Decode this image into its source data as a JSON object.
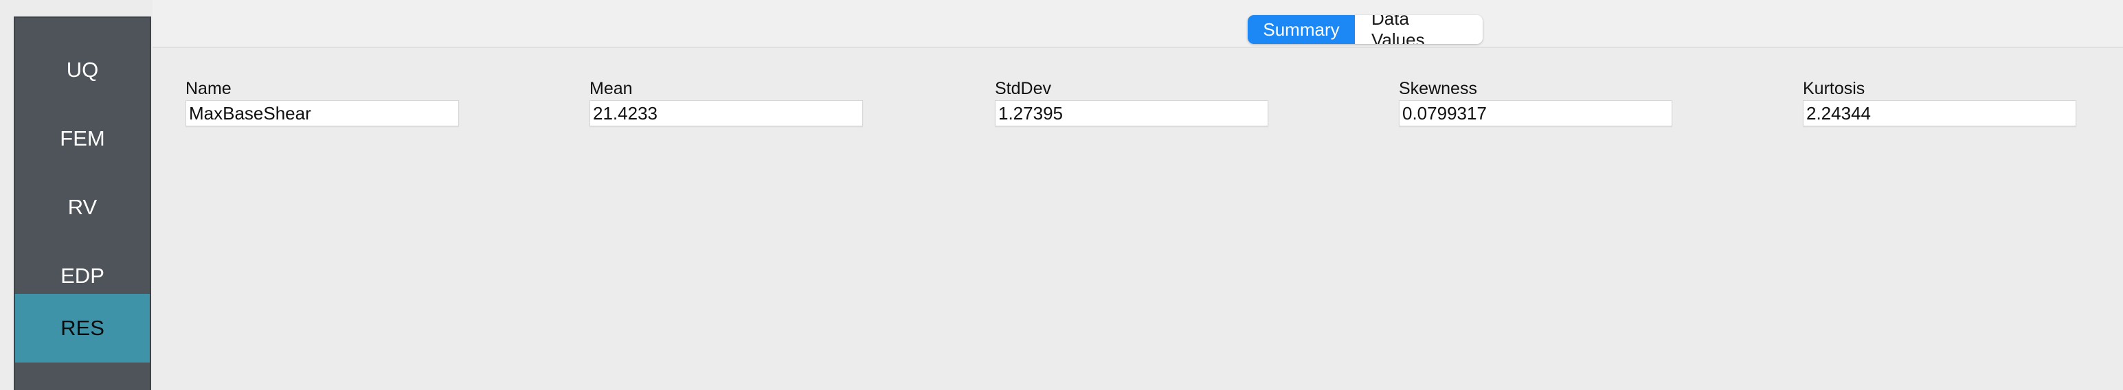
{
  "sidebar": {
    "items": [
      {
        "label": "UQ",
        "active": false
      },
      {
        "label": "FEM",
        "active": false
      },
      {
        "label": "RV",
        "active": false
      },
      {
        "label": "EDP",
        "active": false
      },
      {
        "label": "RES",
        "active": true
      }
    ]
  },
  "tabs": {
    "summary": "Summary",
    "data_values": "Data Values"
  },
  "results": {
    "name_label": "Name",
    "name_value": "MaxBaseShear",
    "mean_label": "Mean",
    "mean_value": "21.4233",
    "stddev_label": "StdDev",
    "stddev_value": "1.27395",
    "skewness_label": "Skewness",
    "skewness_value": "0.0799317",
    "kurtosis_label": "Kurtosis",
    "kurtosis_value": "2.24344"
  },
  "colors": {
    "sidebar_bg": "#4f535a",
    "sidebar_active": "#3e93a8",
    "tab_active": "#1b88f5",
    "content_bg": "#ececec"
  }
}
